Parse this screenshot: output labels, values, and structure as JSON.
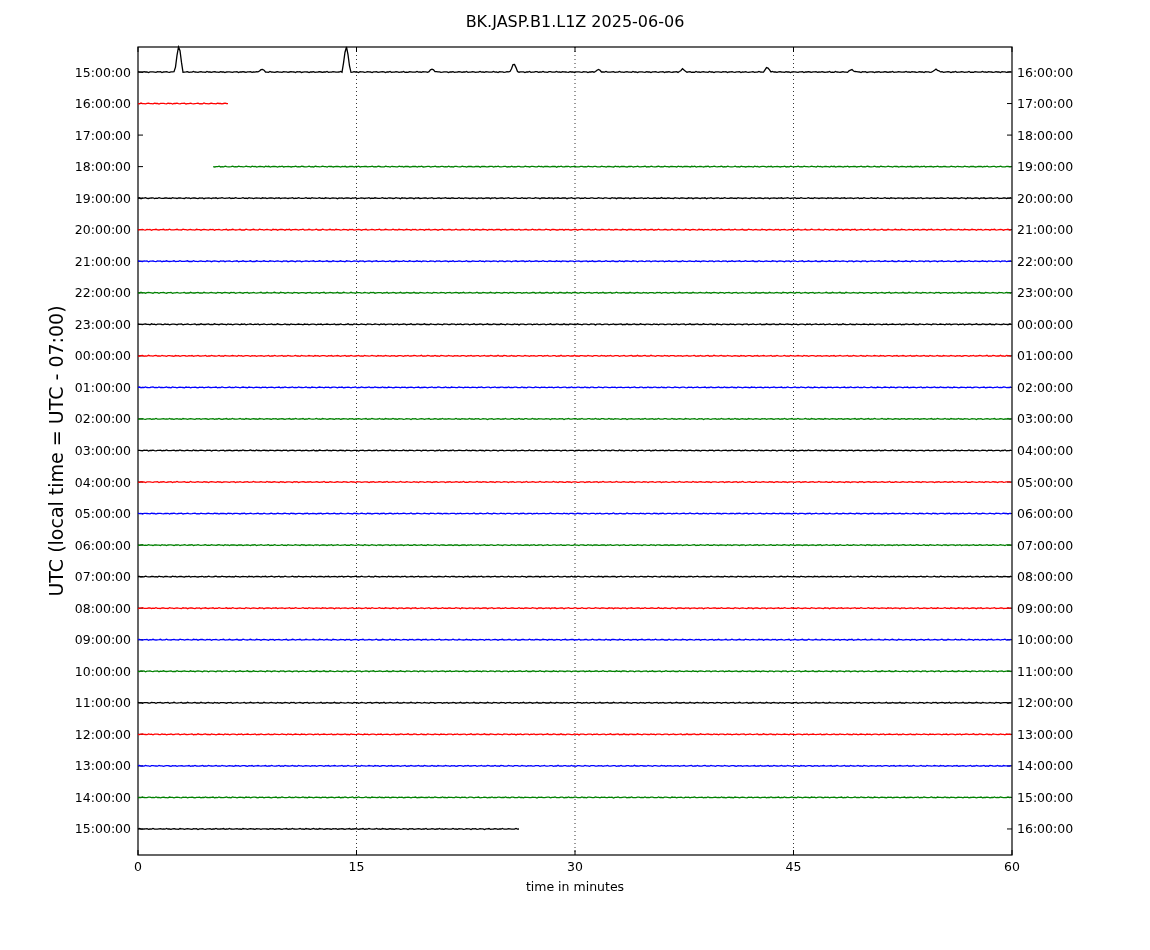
{
  "title": "BK.JASP.B1.L1Z 2025-06-06",
  "ylabel": "UTC (local time = UTC - 07:00)",
  "xlabel": "time in minutes",
  "xticks": [
    "0",
    "15",
    "30",
    "45",
    "60"
  ],
  "rows": [
    {
      "left": "15:00:00",
      "right": "16:00:00",
      "kind": "spiky",
      "color": "#000000"
    },
    {
      "left": "16:00:00",
      "right": "17:00:00",
      "kind": "short_end",
      "color": "#ff0000"
    },
    {
      "left": "17:00:00",
      "right": "18:00:00",
      "kind": "empty"
    },
    {
      "left": "18:00:00",
      "right": "19:00:00",
      "kind": "late_start",
      "color": "#008000"
    },
    {
      "left": "19:00:00",
      "right": "20:00:00",
      "kind": "full",
      "color": "#000000"
    },
    {
      "left": "20:00:00",
      "right": "21:00:00",
      "kind": "full",
      "color": "#ff0000"
    },
    {
      "left": "21:00:00",
      "right": "22:00:00",
      "kind": "full",
      "color": "#0000ff"
    },
    {
      "left": "22:00:00",
      "right": "23:00:00",
      "kind": "full",
      "color": "#008000"
    },
    {
      "left": "23:00:00",
      "right": "00:00:00",
      "kind": "full",
      "color": "#000000"
    },
    {
      "left": "00:00:00",
      "right": "01:00:00",
      "kind": "full",
      "color": "#ff0000"
    },
    {
      "left": "01:00:00",
      "right": "02:00:00",
      "kind": "full",
      "color": "#0000ff"
    },
    {
      "left": "02:00:00",
      "right": "03:00:00",
      "kind": "full",
      "color": "#008000"
    },
    {
      "left": "03:00:00",
      "right": "04:00:00",
      "kind": "full",
      "color": "#000000"
    },
    {
      "left": "04:00:00",
      "right": "05:00:00",
      "kind": "full",
      "color": "#ff0000"
    },
    {
      "left": "05:00:00",
      "right": "06:00:00",
      "kind": "full",
      "color": "#0000ff"
    },
    {
      "left": "06:00:00",
      "right": "07:00:00",
      "kind": "full",
      "color": "#008000"
    },
    {
      "left": "07:00:00",
      "right": "08:00:00",
      "kind": "full",
      "color": "#000000"
    },
    {
      "left": "08:00:00",
      "right": "09:00:00",
      "kind": "full",
      "color": "#ff0000"
    },
    {
      "left": "09:00:00",
      "right": "10:00:00",
      "kind": "full",
      "color": "#0000ff"
    },
    {
      "left": "10:00:00",
      "right": "11:00:00",
      "kind": "full",
      "color": "#008000"
    },
    {
      "left": "11:00:00",
      "right": "12:00:00",
      "kind": "full",
      "color": "#000000"
    },
    {
      "left": "12:00:00",
      "right": "13:00:00",
      "kind": "full",
      "color": "#ff0000"
    },
    {
      "left": "13:00:00",
      "right": "14:00:00",
      "kind": "full",
      "color": "#0000ff"
    },
    {
      "left": "14:00:00",
      "right": "15:00:00",
      "kind": "full",
      "color": "#008000"
    },
    {
      "left": "15:00:00",
      "right": "16:00:00",
      "kind": "half_end",
      "color": "#000000"
    }
  ]
}
